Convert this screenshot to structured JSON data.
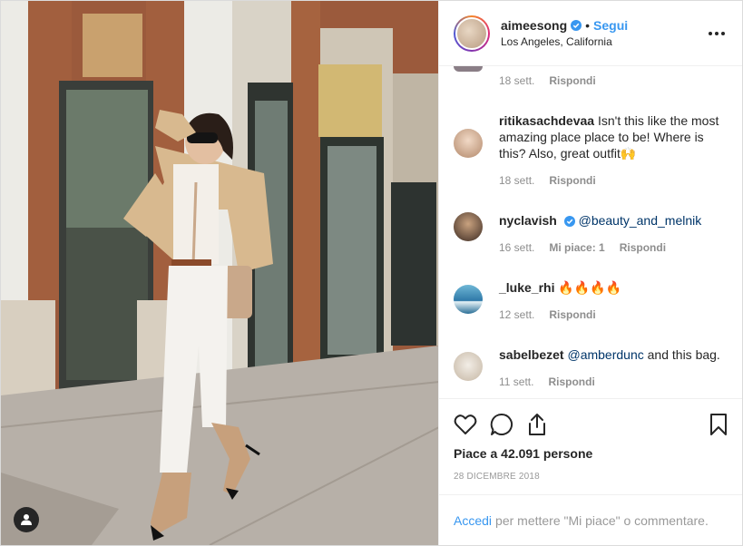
{
  "post": {
    "username": "aimeesong",
    "follow_label": "Segui",
    "separator": "•",
    "location": "Los Angeles, California",
    "more_label": "•••",
    "likes_text": "Piace a 42.091 persone",
    "date": "28 DICEMBRE 2018"
  },
  "comments": [
    {
      "username": "",
      "text": "",
      "time": "18 sett.",
      "reply": "Rispondi"
    },
    {
      "username": "ritikasachdevaa",
      "text": "Isn't this like the most amazing place place to be! Where is this? Also, great outfit🙌",
      "time": "18 sett.",
      "reply": "Rispondi"
    },
    {
      "username": "nyclavish",
      "mention": "@beauty_and_melnik",
      "time": "16 sett.",
      "likes": "Mi piace: 1",
      "reply": "Rispondi"
    },
    {
      "username": "_luke_rhi",
      "text": "🔥🔥🔥🔥",
      "time": "12 sett.",
      "reply": "Rispondi"
    },
    {
      "username": "sabelbezet",
      "mention": "@amberdunc",
      "text": "and this bag.",
      "time": "11 sett.",
      "reply": "Rispondi"
    }
  ],
  "footer": {
    "login_label": "Accedi",
    "prompt": "per mettere \"Mi piace\" o commentare."
  },
  "icons": {
    "like": "heart-icon",
    "comment": "comment-bubble-icon",
    "share": "share-icon",
    "save": "bookmark-icon",
    "tags": "user-tag-icon"
  },
  "colors": {
    "link": "#3897f0",
    "mention": "#003569",
    "muted": "#8e8e8e",
    "border": "#efefef"
  }
}
